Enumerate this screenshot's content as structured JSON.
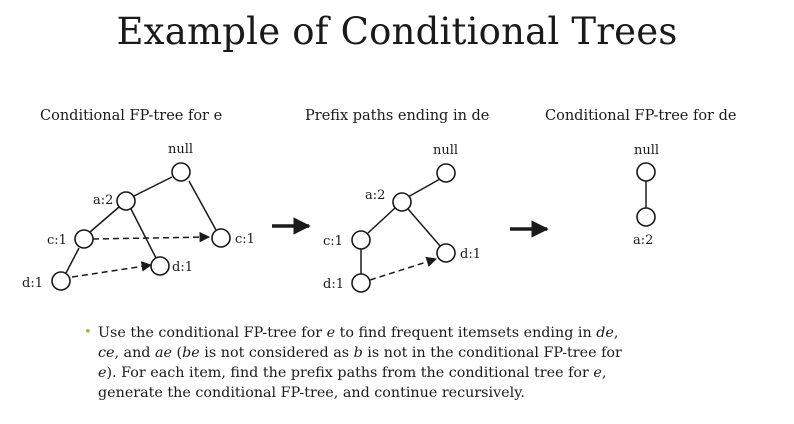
{
  "slide": {
    "title": "Example of Conditional Trees"
  },
  "panels": [
    {
      "title": "Conditional FP-tree for e",
      "nodes": {
        "null": "null",
        "a": "a:2",
        "c": "c:1",
        "d": "d:1",
        "d2": "d:1",
        "c2": "c:1"
      }
    },
    {
      "title": "Prefix paths ending in de",
      "nodes": {
        "null": "null",
        "a": "a:2",
        "c": "c:1",
        "d": "d:1",
        "d2": "d:1"
      }
    },
    {
      "title": "Conditional FP-tree for de",
      "nodes": {
        "null": "null",
        "a": "a:2"
      }
    }
  ],
  "bullet": {
    "p1": "Use the conditional FP-tree for ",
    "e1": "e",
    "p2": " to find frequent itemsets ending in ",
    "de": "de",
    "p3": ",",
    "ce": "ce",
    "p4": ", and ",
    "ae": "ae",
    "p5": " (",
    "be": "be",
    "p6": " is not considered as ",
    "b": "b",
    "p7": " is not in the conditional FP-tree for",
    "e2": "e",
    "p8": "). For each item, find the prefix paths from the conditional tree for ",
    "e3": "e",
    "p9": ",",
    "p10": "generate the conditional FP-tree, and continue recursively."
  },
  "colors": {
    "bullet_marker": "#8fbf3f",
    "stroke": "#1a1a1a"
  }
}
